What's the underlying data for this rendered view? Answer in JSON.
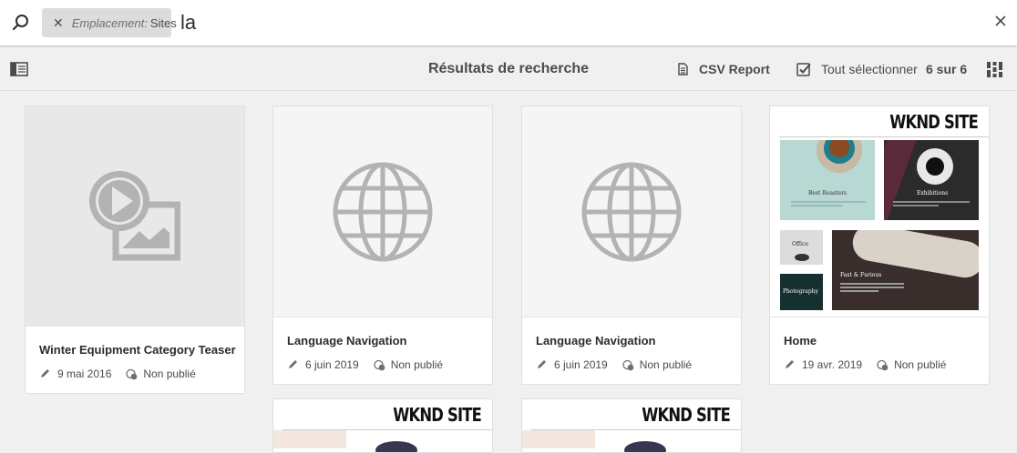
{
  "search": {
    "tag_key": "Emplacement:",
    "tag_value": "Sites",
    "query": "la"
  },
  "actionbar": {
    "title": "Résultats de recherche",
    "csv_label": "CSV Report",
    "select_all_label": "Tout sélectionner",
    "count_label": "6 sur 6"
  },
  "cards": [
    {
      "title": "Winter Equipment Category Teaser",
      "date": "9 mai 2016",
      "status": "Non publié",
      "thumb": "video-asset-icon"
    },
    {
      "title": "Language Navigation",
      "date": "6 juin 2019",
      "status": "Non publié",
      "thumb": "globe-icon"
    },
    {
      "title": "Language Navigation",
      "date": "6 juin 2019",
      "status": "Non publié",
      "thumb": "globe-icon"
    },
    {
      "title": "Home",
      "date": "19 avr. 2019",
      "status": "Non publié",
      "thumb": "wknd-site-preview"
    }
  ],
  "wknd": {
    "logo": "WKND SITE",
    "tiles": {
      "roasters": "Best Roasters",
      "exhibitions": "Exhibitions",
      "office": "Office",
      "furious": "Fast & Furious",
      "photography": "Photography"
    }
  },
  "colors": {
    "background": "#f0f0f0",
    "card": "#ffffff",
    "thumb_gray": "#e8e8e8",
    "icon_gray": "#b3b3b3"
  }
}
